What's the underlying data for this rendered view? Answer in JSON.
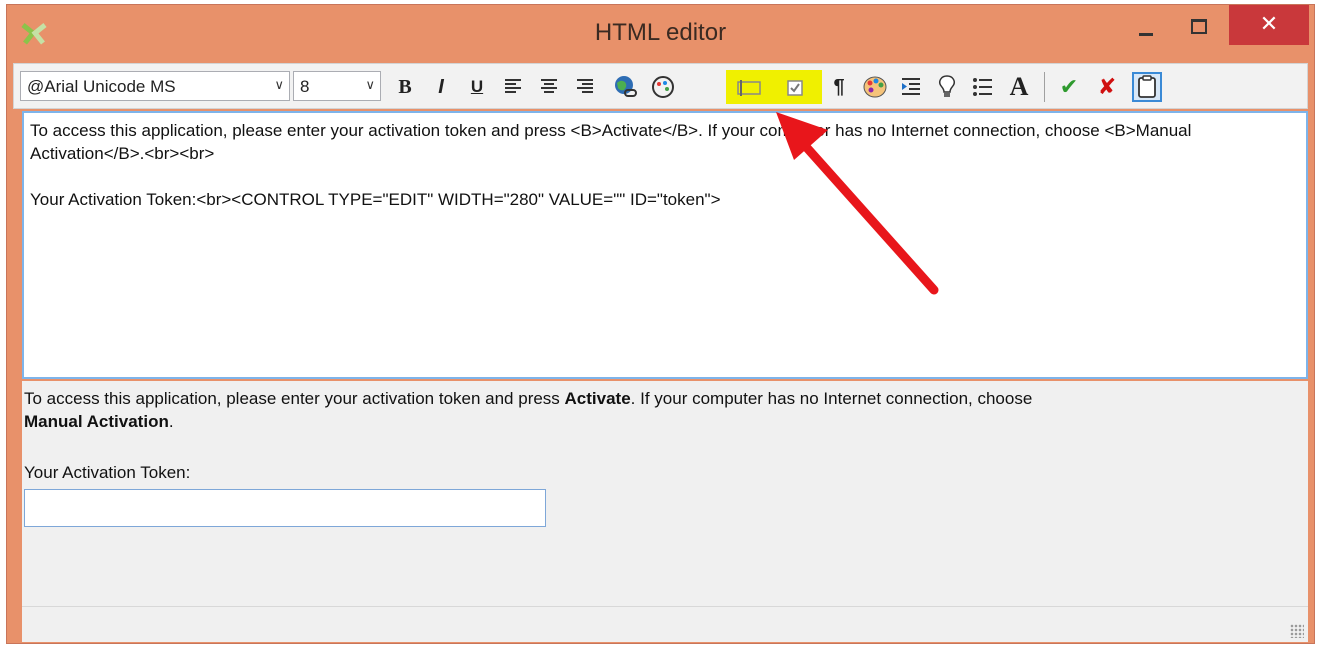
{
  "window": {
    "title": "HTML editor",
    "close_glyph": "✕"
  },
  "toolbar": {
    "font": "@Arial Unicode MS",
    "size": "8",
    "bold": "B",
    "italic": "I",
    "underline": "U",
    "paragraph": "¶",
    "font_glyph": "A",
    "ok_glyph": "✔",
    "cancel_glyph": "✘"
  },
  "editor": {
    "source": "To access this application, please enter your activation token and press <B>Activate</B>. If your computer has no Internet connection, choose <B>Manual Activation</B>.<br><br>\n\nYour Activation Token:<br><CONTROL TYPE=\"EDIT\" WIDTH=\"280\" VALUE=\"\" ID=\"token\">"
  },
  "preview": {
    "line1_before": "To access this application, please enter your activation token and press ",
    "activate": "Activate",
    "line1_after": ". If your computer has no Internet connection, choose ",
    "manual": "Manual Activation",
    "period": ".",
    "token_label": "Your Activation Token:",
    "token_value": ""
  },
  "colors": {
    "titlebar": "#E8916A",
    "close_button": "#C9383B",
    "highlight": "#F0F000",
    "annotation_arrow": "#E8161B",
    "ok_green": "#2E9A2E",
    "cancel_red": "#D01010"
  }
}
